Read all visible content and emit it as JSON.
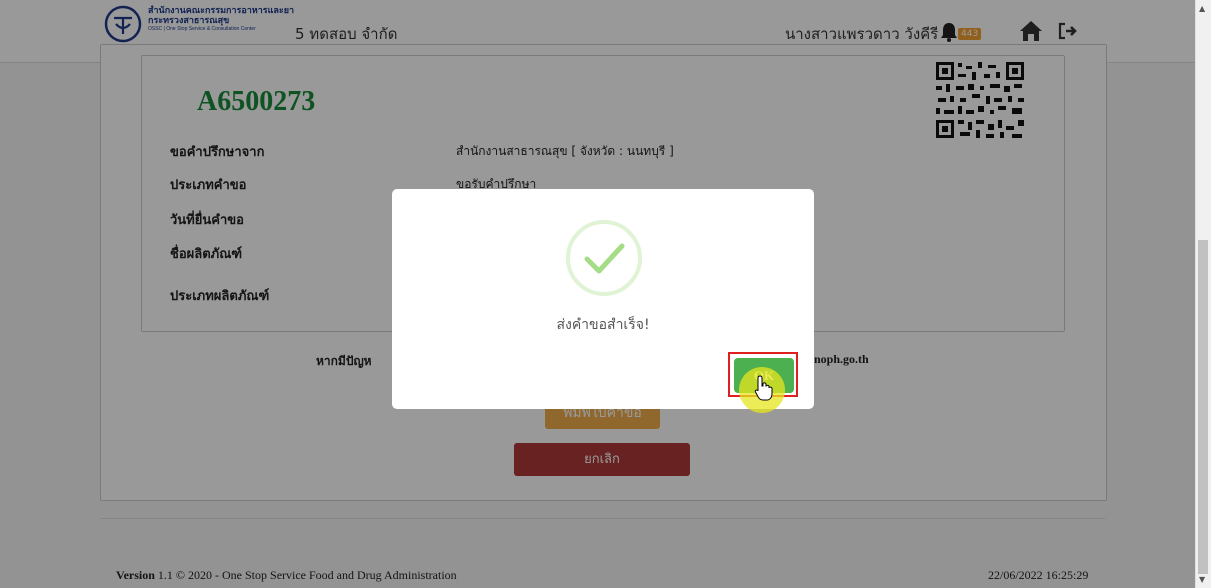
{
  "header": {
    "logo_lines": [
      "สำนักงานคณะกรรมการอาหารและยา",
      "กระทรวงสาธารณสุข",
      "OSSC | One Stop Service & Consultation Center"
    ],
    "company": "5 ทดสอบ จำกัด",
    "username": "นางสาวแพรวดาว วังคีรี",
    "notification_count": "443",
    "icons": [
      "bell-icon",
      "home-icon",
      "logout-icon"
    ]
  },
  "request": {
    "reference": "A6500273",
    "fields": [
      {
        "label": "ขอคำปรึกษาจาก",
        "value": "สำนักงานสาธารณสุข [ จังหวัด : นนทบุรี ]"
      },
      {
        "label": "ประเภทคำขอ",
        "value": "ขอรับคำปรึกษา"
      },
      {
        "label": "วันที่ยื่นคำขอ",
        "value": ""
      },
      {
        "label": "ชื่อผลิตภัณฑ์",
        "value": ""
      },
      {
        "label": "ประเภทผลิตภัณฑ์",
        "value": ""
      }
    ]
  },
  "contact": {
    "prefix": "หากมีปัญห",
    "suffix": "noph.go.th"
  },
  "buttons": {
    "print": "พิมพ์ใบคำขอ",
    "cancel": "ยกเลิก"
  },
  "footer": {
    "version_label": "Version",
    "version_text": "1.1 © 2020 - One Stop Service Food and Drug Administration",
    "datetime": "22/06/2022 16:25:29"
  },
  "modal": {
    "message": "ส่งคำขอสำเร็จ!",
    "ok_label": "OK",
    "icon": "success-check-icon"
  },
  "colors": {
    "reference": "#1a8a3a",
    "ok_button": "#4caf50",
    "cancel_button": "#b03a3a",
    "print_button": "#f0ad4e",
    "badge": "#f0a030"
  }
}
